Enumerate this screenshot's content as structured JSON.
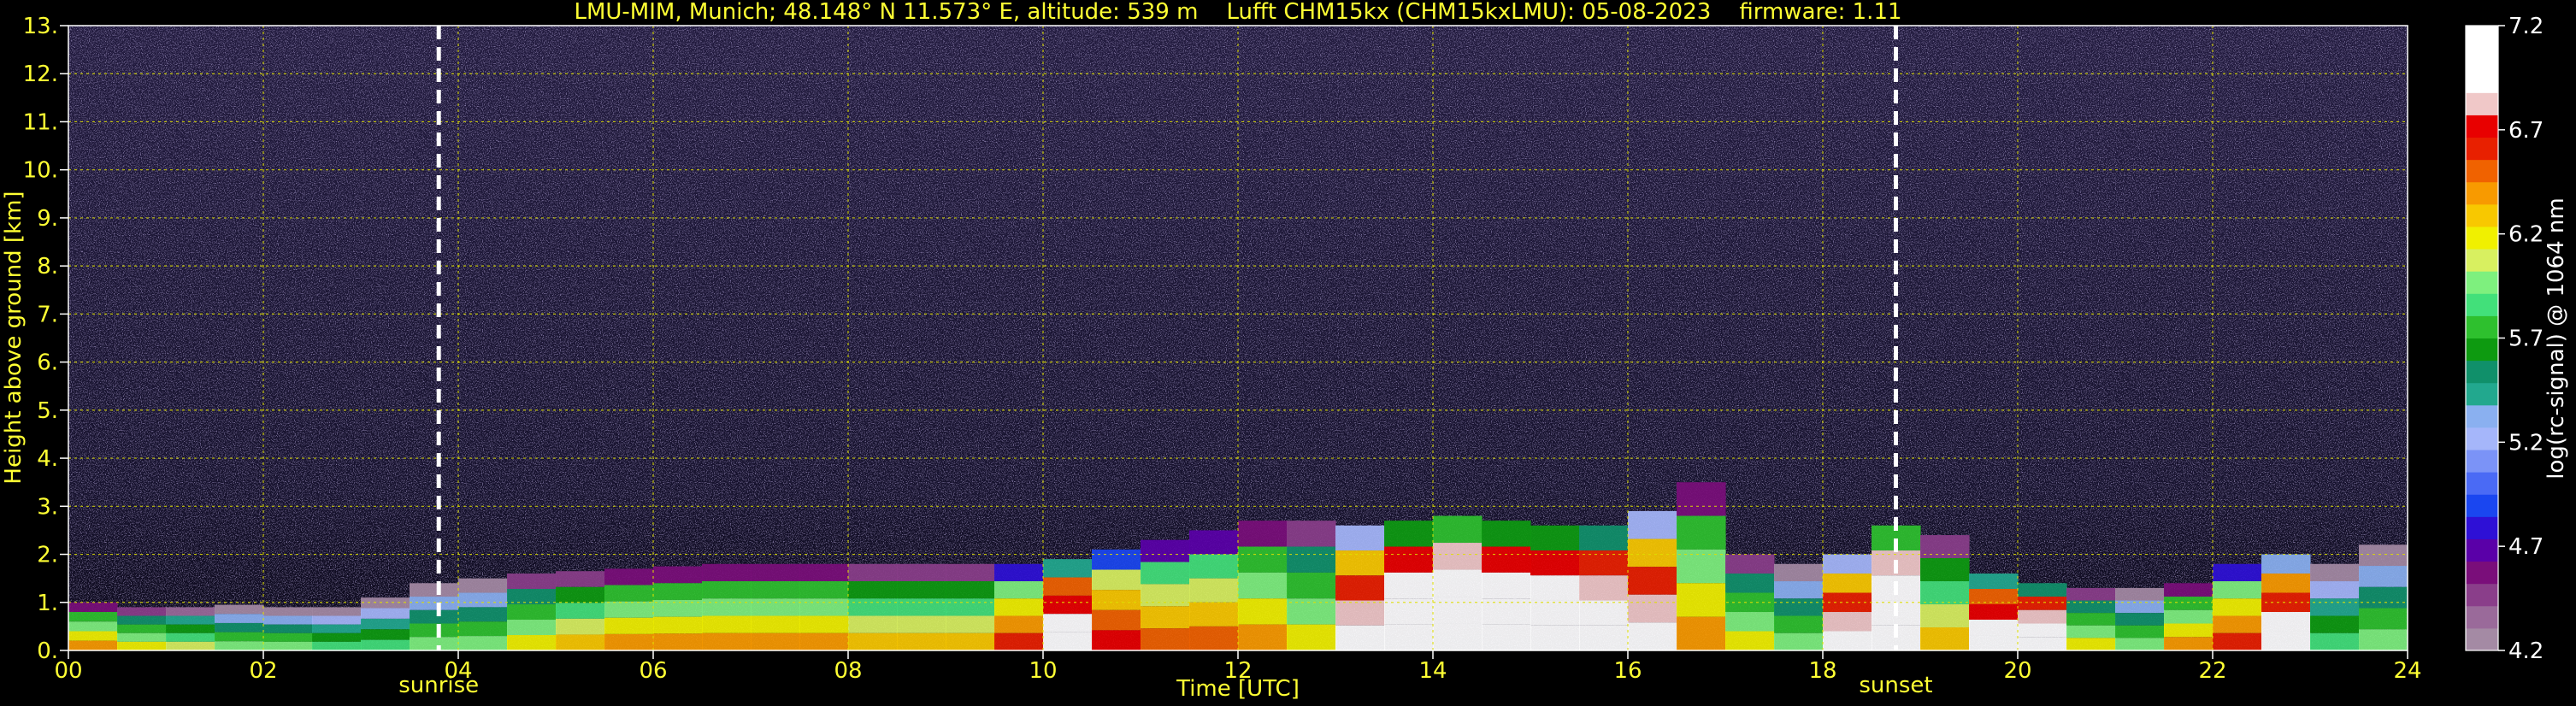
{
  "chart_data": {
    "type": "heatmap",
    "title": "LMU-MIM, Munich; 48.148° N 11.573° E, altitude: 539 m    Lufft CHM15kx (CHM15kxLMU): 05-08-2023    firmware: 1.11",
    "xlabel": "Time [UTC]",
    "ylabel": "Height above ground [km]",
    "xlim": [
      0,
      24
    ],
    "ylim": [
      0,
      13
    ],
    "x_ticks": [
      0,
      2,
      4,
      6,
      8,
      10,
      12,
      14,
      16,
      18,
      20,
      22,
      24
    ],
    "x_tick_labels": [
      "00",
      "02",
      "04",
      "06",
      "08",
      "10",
      "12",
      "14",
      "16",
      "18",
      "20",
      "22",
      "24"
    ],
    "y_ticks": [
      0,
      1,
      2,
      3,
      4,
      5,
      6,
      7,
      8,
      9,
      10,
      11,
      12,
      13
    ],
    "y_tick_labels": [
      "0.",
      "1.",
      "2.",
      "3.",
      "4.",
      "5.",
      "6.",
      "7.",
      "8.",
      "9.",
      "10.",
      "11.",
      "12.",
      "13."
    ],
    "grid": true,
    "events": [
      {
        "label": "sunrise",
        "x": 3.8
      },
      {
        "label": "sunset",
        "x": 18.75
      }
    ],
    "colorbar": {
      "label": "log(rc-signal) @ 1064 nm",
      "range": [
        4.2,
        7.2
      ],
      "ticks": [
        4.2,
        4.7,
        5.2,
        5.7,
        6.2,
        6.7,
        7.2
      ],
      "tick_labels": [
        "4.2",
        "4.7",
        "5.2",
        "5.7",
        "6.2",
        "6.7",
        "7.2"
      ],
      "colors": [
        "#a48aa4",
        "#9a6a9a",
        "#8a3e8a",
        "#7a0e7a",
        "#5a00a8",
        "#2e10d6",
        "#1a46f0",
        "#4a6af5",
        "#7b93f7",
        "#a5b6fa",
        "#8ab0f0",
        "#22a88e",
        "#10906a",
        "#0d9a10",
        "#2ec02e",
        "#42e07a",
        "#7ef07e",
        "#d8f060",
        "#f0f000",
        "#f8c800",
        "#f89a00",
        "#f06200",
        "#e82000",
        "#e80000",
        "#f0c8c8",
        "#ffffff",
        "#ffffff",
        "#ffffff"
      ]
    },
    "signal_profile": {
      "hours": [
        0,
        0.5,
        1,
        1.5,
        2,
        2.5,
        3,
        3.5,
        4,
        4.5,
        5,
        5.5,
        6,
        6.5,
        7,
        7.5,
        8,
        8.5,
        9,
        9.5,
        10,
        10.5,
        11,
        11.5,
        12,
        12.5,
        13,
        13.5,
        14,
        14.5,
        15,
        15.5,
        16,
        16.5,
        17,
        17.5,
        18,
        18.5,
        19,
        19.5,
        20,
        20.5,
        21,
        21.5,
        22,
        22.5,
        23,
        23.5,
        24
      ],
      "boundary_layer_top_km": [
        1.0,
        0.9,
        0.9,
        0.95,
        0.9,
        0.9,
        1.1,
        1.4,
        1.5,
        1.6,
        1.65,
        1.7,
        1.75,
        1.8,
        1.8,
        1.8,
        1.8,
        1.8,
        1.8,
        1.8,
        1.9,
        2.1,
        2.3,
        2.5,
        2.7,
        2.7,
        2.6,
        2.7,
        2.8,
        2.7,
        2.6,
        2.6,
        2.9,
        3.5,
        2.0,
        1.8,
        2.0,
        2.6,
        2.4,
        1.6,
        1.4,
        1.3,
        1.3,
        1.4,
        1.8,
        2.0,
        1.8,
        2.2,
        1.2
      ],
      "intensity": [
        6.0,
        5.8,
        5.7,
        5.6,
        5.6,
        5.5,
        5.5,
        5.6,
        5.6,
        5.8,
        5.9,
        6.0,
        6.0,
        6.0,
        6.0,
        6.0,
        5.9,
        5.9,
        5.9,
        6.2,
        6.8,
        6.3,
        6.1,
        6.1,
        6.0,
        5.8,
        6.6,
        7.0,
        7.1,
        7.0,
        7.0,
        6.9,
        6.6,
        6.0,
        5.8,
        5.6,
        6.6,
        7.1,
        5.9,
        6.8,
        6.9,
        5.8,
        5.6,
        6.0,
        6.2,
        6.7,
        5.5,
        5.6,
        5.6
      ]
    }
  }
}
